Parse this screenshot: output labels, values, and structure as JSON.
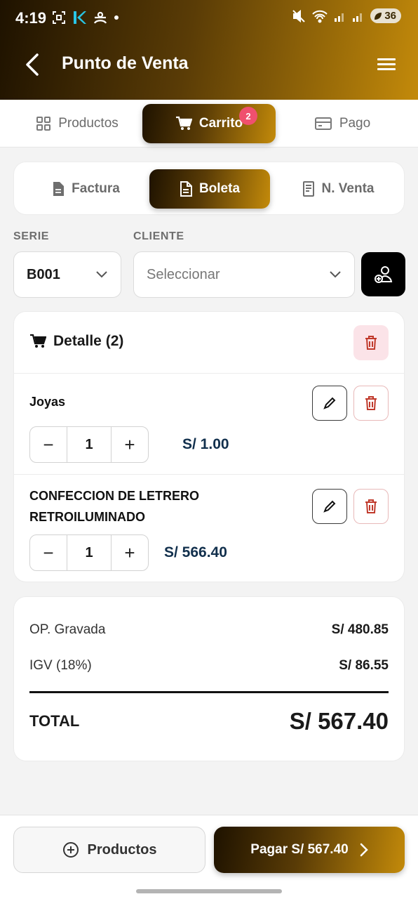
{
  "status_bar": {
    "time": "4:19",
    "battery": "36"
  },
  "header": {
    "title": "Punto de Venta"
  },
  "tabs": [
    {
      "label": "Productos",
      "icon": "grid-icon"
    },
    {
      "label": "Carrito",
      "icon": "cart-icon",
      "badge": "2",
      "active": true
    },
    {
      "label": "Pago",
      "icon": "card-icon"
    }
  ],
  "doc_types": [
    {
      "label": "Factura",
      "icon": "document-filled-icon"
    },
    {
      "label": "Boleta",
      "icon": "document-outline-icon",
      "active": true
    },
    {
      "label": "N. Venta",
      "icon": "note-icon"
    }
  ],
  "form": {
    "serie_label": "SERIE",
    "serie_value": "B001",
    "cliente_label": "CLIENTE",
    "cliente_placeholder": "Seleccionar"
  },
  "detail": {
    "title": "Detalle (2)",
    "items": [
      {
        "name": "Joyas",
        "qty": "1",
        "price": "S/ 1.00"
      },
      {
        "name_line1": "CONFECCION DE LETRERO",
        "name_line2": "RETROILUMINADO",
        "qty": "1",
        "price": "S/ 566.40"
      }
    ]
  },
  "totals": {
    "gravada_label": "OP. Gravada",
    "gravada_value": "S/ 480.85",
    "igv_label": "IGV (18%)",
    "igv_value": "S/ 86.55",
    "total_label": "TOTAL",
    "total_value": "S/ 567.40"
  },
  "footer": {
    "products_label": "Productos",
    "pay_label": "Pagar S/ 567.40"
  },
  "colors": {
    "gradient_start": "#1e1200",
    "gradient_end": "#c38a0a",
    "badge": "#f0506e",
    "price": "#12304d",
    "delete": "#c0392b"
  }
}
